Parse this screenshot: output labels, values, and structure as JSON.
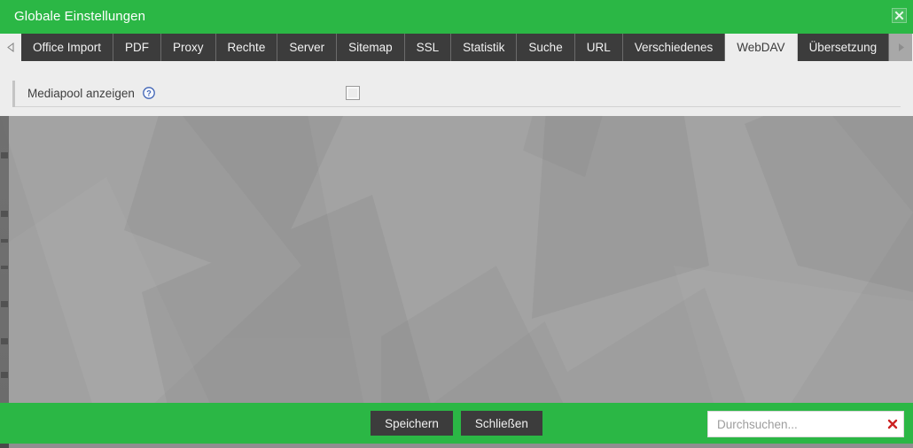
{
  "window": {
    "title": "Globale Einstellungen",
    "close_label": "×",
    "close_icon": "close-icon",
    "accent_green": "#2bb745",
    "dark_chrome": "#3c3c3c",
    "panel_bg": "#ededed"
  },
  "tabs": {
    "scroll_left_icon": "chevron-left-icon",
    "scroll_right_icon": "chevron-right-icon",
    "menu_icon": "chevron-down-icon",
    "items": [
      {
        "label": "Office Import",
        "active": false
      },
      {
        "label": "PDF",
        "active": false
      },
      {
        "label": "Proxy",
        "active": false
      },
      {
        "label": "Rechte",
        "active": false
      },
      {
        "label": "Server",
        "active": false
      },
      {
        "label": "Sitemap",
        "active": false
      },
      {
        "label": "SSL",
        "active": false
      },
      {
        "label": "Statistik",
        "active": false
      },
      {
        "label": "Suche",
        "active": false
      },
      {
        "label": "URL",
        "active": false
      },
      {
        "label": "Verschiedenes",
        "active": false
      },
      {
        "label": "WebDAV",
        "active": true
      },
      {
        "label": "Übersetzung",
        "active": false
      }
    ]
  },
  "panel": {
    "fields": [
      {
        "label": "Mediapool anzeigen",
        "help_icon": "help-circle-icon",
        "control": "checkbox",
        "checked": false
      }
    ]
  },
  "footer": {
    "save_label": "Speichern",
    "close_label": "Schließen",
    "search": {
      "placeholder": "Durchsuchen...",
      "value": "",
      "clear_icon": "clear-x-icon",
      "clear_color": "#cc2222"
    }
  }
}
